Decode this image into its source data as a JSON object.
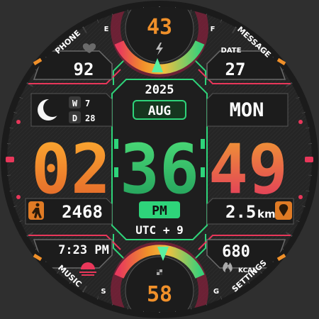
{
  "complications": {
    "top": {
      "value": "43",
      "letter_left": "E",
      "letter_right": "F"
    },
    "bottom": {
      "value": "58",
      "letter_left": "S",
      "letter_right": "G"
    },
    "phone": {
      "label": "PHONE",
      "value": "92"
    },
    "message": {
      "label": "MESSAGE",
      "sublabel": "DATE",
      "value": "27"
    },
    "music": {
      "label": "MUSIC",
      "value": "7:23 PM"
    },
    "settings": {
      "label": "SETTINGS",
      "sublabel": "KCAL",
      "value": "680"
    },
    "steps": {
      "value": "2468"
    },
    "distance": {
      "value": "2.5",
      "unit": "km"
    }
  },
  "date": {
    "year": "2025",
    "month": "AUG",
    "weekday": "MON",
    "week_label": "W",
    "week_value": "7",
    "day_label": "D",
    "day_value": "28"
  },
  "time": {
    "hour": "02",
    "minute": "36",
    "second": "49",
    "ampm": "PM",
    "timezone": "UTC + 9"
  },
  "colors": {
    "hour": "#f0902a",
    "minute": "#34c36a",
    "second": "#e8375a",
    "accent_green": "#2ed47a",
    "background": "#232323"
  },
  "icons": [
    "heart-icon",
    "bolt-icon",
    "moon-phase-icon",
    "walk-icon",
    "location-icon",
    "sunset-icon",
    "flame-icon",
    "chess-icon"
  ]
}
